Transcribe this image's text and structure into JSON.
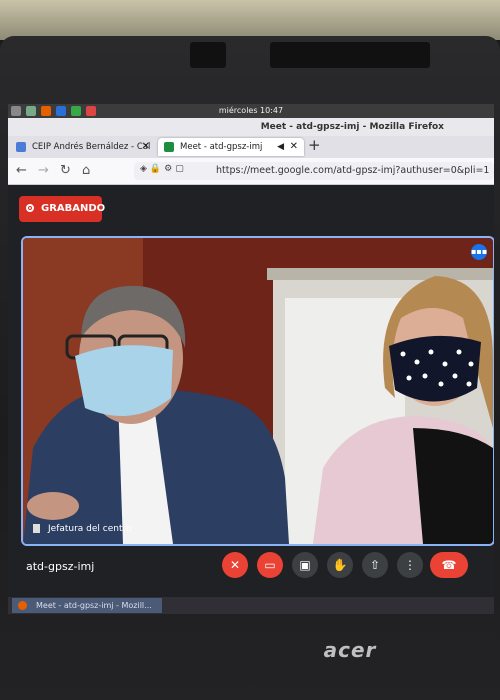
{
  "system_panel": {
    "clock": "miércoles 10:47"
  },
  "window": {
    "title": "Meet - atd-gpsz-imj - Mozilla Firefox"
  },
  "tabs": [
    {
      "label": "CEIP Andrés Bernáldez - Cal",
      "active": false
    },
    {
      "label": "Meet - atd-gpsz-imj",
      "active": true
    }
  ],
  "address_bar": {
    "url": "https://meet.google.com/atd-gpsz-imj?authuser=0&pli=1"
  },
  "meet": {
    "recording_label": "GRABANDO",
    "participant_name": "Jefatura del centro",
    "meeting_code": "atd-gpsz-imj",
    "controls": [
      "mic-off-icon",
      "camera-off-icon",
      "captions-icon",
      "raise-hand-icon",
      "present-icon",
      "more-options-icon",
      "hang-up-icon"
    ]
  },
  "taskbar": {
    "item": "Meet - atd-gpsz-imj - Mozill..."
  },
  "laptop": {
    "brand": "acer"
  },
  "colors": {
    "record_red": "#d93025",
    "active_border": "#8ab4f8",
    "meet_bg": "#202124"
  }
}
